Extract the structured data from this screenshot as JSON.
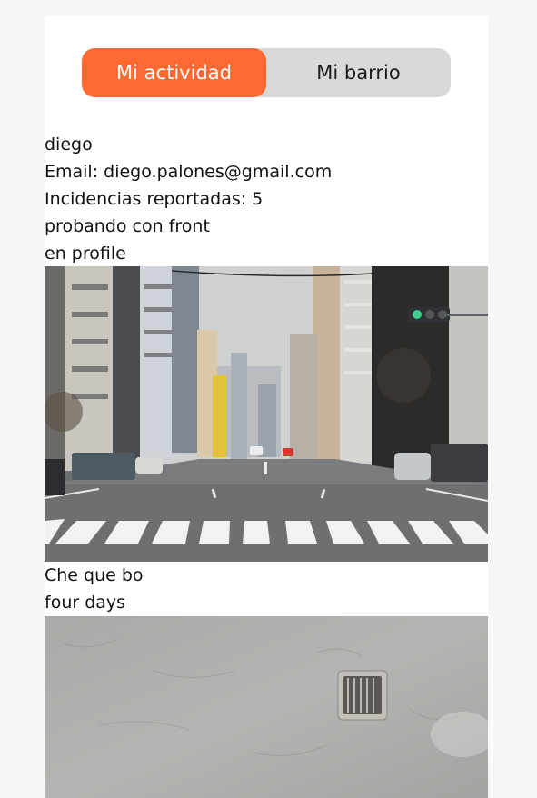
{
  "tabs": {
    "activity_label": "Mi actividad",
    "neighborhood_label": "Mi barrio"
  },
  "profile": {
    "name": "diego",
    "email_line": "Email: diego.palones@gmail.com",
    "incidents_line": "Incidencias reportadas: 5"
  },
  "posts": [
    {
      "title": "probando con front",
      "description": "en profile",
      "image": "city-street-crosswalk-photo"
    },
    {
      "title": "Che que bo",
      "description": "four days",
      "image": "gray-wall-vent-photo"
    }
  ],
  "colors": {
    "accent": "#ff6a33",
    "tab_bg": "#d9d9d9",
    "page_bg": "#f7f7f7"
  }
}
